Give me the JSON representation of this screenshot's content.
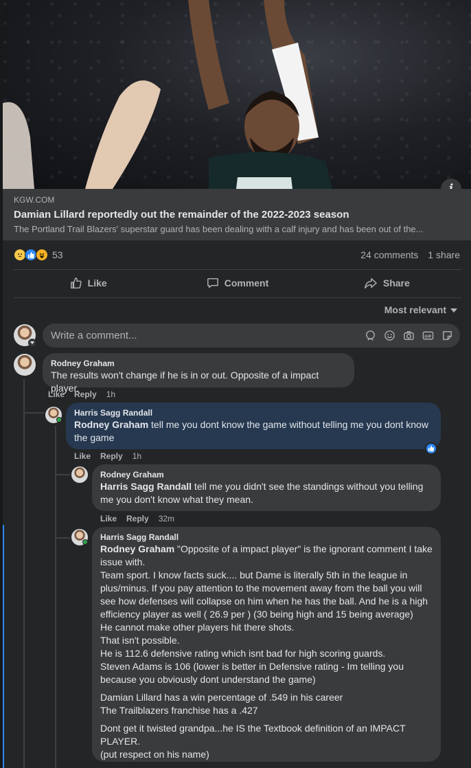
{
  "link": {
    "domain": "KGW.COM",
    "title": "Damian Lillard reportedly out the remainder of the 2022-2023 season",
    "description": "The Portland Trail Blazers' superstar guard has been dealing with a calf injury and has been out of the..."
  },
  "stats": {
    "reaction_count": "53",
    "comments": "24 comments",
    "shares": "1 share"
  },
  "actions": {
    "like": "Like",
    "comment": "Comment",
    "share": "Share"
  },
  "sort": {
    "label": "Most relevant"
  },
  "composer": {
    "placeholder": "Write a comment..."
  },
  "comments": [
    {
      "author": "Rodney Graham",
      "text": "The results won't change if he is in or out. Opposite of a impact player.",
      "like": "Like",
      "reply": "Reply",
      "time": "1h"
    },
    {
      "author": "Harris Sagg Randall",
      "mention": "Rodney Graham",
      "text": " tell me you dont know the game without telling me you dont know the game",
      "like": "Like",
      "reply": "Reply",
      "time": "1h"
    },
    {
      "author": "Rodney Graham",
      "mention": "Harris Sagg Randall",
      "text": " tell me you didn't see the standings without you telling me you don't know what they mean.",
      "like": "Like",
      "reply": "Reply",
      "time": "32m"
    },
    {
      "author": "Harris Sagg Randall",
      "mention": "Rodney Graham",
      "line1": " \"Opposite of a impact player\" is the ignorant comment I take issue with.",
      "line2": "Team sport. I know facts suck.... but Dame is literally 5th in the league in plus/minus. If you pay attention to the movement away from the ball you will see how defenses will collapse on him when he has the ball. And he is a high efficiency player as well ( 26.9 per ) (30 being high and 15 being average)",
      "line3": "He cannot make other players hit there shots.",
      "line4": "That isn't possible.",
      "line5": "He is 112.6 defensive rating which isnt bad for high scoring guards.",
      "line6": "Steven Adams is 106 (lower is better in Defensive rating - Im telling you because you obviously dont understand the game)",
      "line7": "Damian Lillard has a win percentage of .549 in his career",
      "line8": "The Trailblazers franchise has a .427",
      "line9": "Dont get it twisted grandpa...he IS the Textbook definition of an IMPACT PLAYER.",
      "line10": "(put respect on his name)"
    }
  ],
  "colors": {
    "accent": "#2e89ff",
    "reply_bubble": "#263951",
    "bubble": "#3a3b3c",
    "card": "#242526"
  }
}
